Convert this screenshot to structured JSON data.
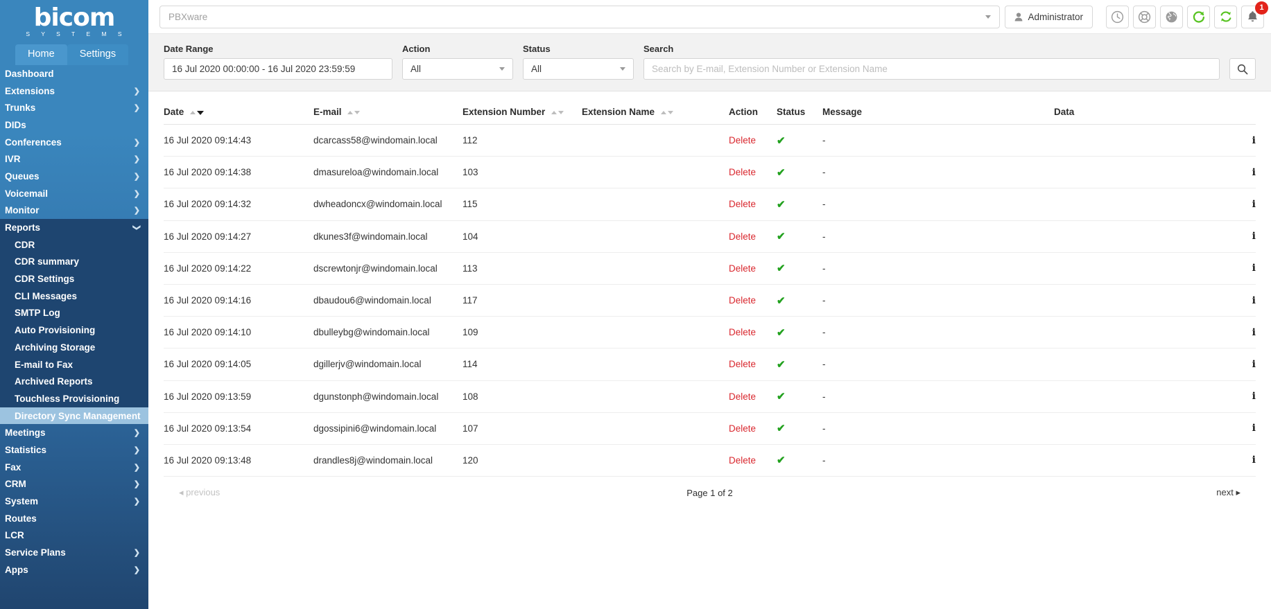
{
  "brand": {
    "name": "bicom",
    "tagline": "S Y S T E M S"
  },
  "tabs": [
    {
      "label": "Home",
      "active": true
    },
    {
      "label": "Settings",
      "active": false
    }
  ],
  "sidebar": {
    "items": [
      {
        "label": "Dashboard",
        "has_arrow": false,
        "expanded": false
      },
      {
        "label": "Extensions",
        "has_arrow": true,
        "expanded": false
      },
      {
        "label": "Trunks",
        "has_arrow": true,
        "expanded": false
      },
      {
        "label": "DIDs",
        "has_arrow": false,
        "expanded": false
      },
      {
        "label": "Conferences",
        "has_arrow": true,
        "expanded": false
      },
      {
        "label": "IVR",
        "has_arrow": true,
        "expanded": false
      },
      {
        "label": "Queues",
        "has_arrow": true,
        "expanded": false
      },
      {
        "label": "Voicemail",
        "has_arrow": true,
        "expanded": false
      },
      {
        "label": "Monitor",
        "has_arrow": true,
        "expanded": false
      },
      {
        "label": "Reports",
        "has_arrow": true,
        "expanded": true
      }
    ],
    "reports_subitems": [
      {
        "label": "CDR",
        "active": false
      },
      {
        "label": "CDR summary",
        "active": false
      },
      {
        "label": "CDR Settings",
        "active": false
      },
      {
        "label": "CLI Messages",
        "active": false
      },
      {
        "label": "SMTP Log",
        "active": false
      },
      {
        "label": "Auto Provisioning",
        "active": false
      },
      {
        "label": "Archiving Storage",
        "active": false
      },
      {
        "label": "E-mail to Fax",
        "active": false
      },
      {
        "label": "Archived Reports",
        "active": false
      },
      {
        "label": "Touchless Provisioning",
        "active": false
      },
      {
        "label": "Directory Sync Management",
        "active": true
      }
    ],
    "items_after": [
      {
        "label": "Meetings",
        "has_arrow": true
      },
      {
        "label": "Statistics",
        "has_arrow": true
      },
      {
        "label": "Fax",
        "has_arrow": true
      },
      {
        "label": "CRM",
        "has_arrow": true
      },
      {
        "label": "System",
        "has_arrow": true
      },
      {
        "label": "Routes",
        "has_arrow": false
      },
      {
        "label": "LCR",
        "has_arrow": false
      },
      {
        "label": "Service Plans",
        "has_arrow": true
      },
      {
        "label": "Apps",
        "has_arrow": true
      }
    ]
  },
  "topbar": {
    "server_select_value": "PBXware",
    "user_label": "Administrator",
    "tools": [
      {
        "name": "clock-icon",
        "title": "Clock"
      },
      {
        "name": "lifebuoy-icon",
        "title": "Support"
      },
      {
        "name": "globe-icon",
        "title": "Language"
      },
      {
        "name": "reload-icon",
        "title": "Reload"
      },
      {
        "name": "sync-icon",
        "title": "Sync"
      },
      {
        "name": "bell-icon",
        "title": "Notifications"
      }
    ],
    "notification_count": "1"
  },
  "filters": {
    "date_range": {
      "label": "Date Range",
      "value": "16 Jul 2020 00:00:00 - 16 Jul 2020 23:59:59"
    },
    "action": {
      "label": "Action",
      "value": "All"
    },
    "status": {
      "label": "Status",
      "value": "All"
    },
    "search": {
      "label": "Search",
      "value": "",
      "placeholder": "Search by E-mail, Extension Number or Extension Name"
    }
  },
  "table": {
    "columns": [
      {
        "key": "date",
        "label": "Date",
        "sortable": true,
        "sort_active": "desc"
      },
      {
        "key": "email",
        "label": "E-mail",
        "sortable": true,
        "sort_active": ""
      },
      {
        "key": "extension_number",
        "label": "Extension Number",
        "sortable": true,
        "sort_active": ""
      },
      {
        "key": "extension_name",
        "label": "Extension Name",
        "sortable": true,
        "sort_active": ""
      },
      {
        "key": "action",
        "label": "Action",
        "sortable": false,
        "sort_active": ""
      },
      {
        "key": "status",
        "label": "Status",
        "sortable": false,
        "sort_active": ""
      },
      {
        "key": "message",
        "label": "Message",
        "sortable": false,
        "sort_active": ""
      },
      {
        "key": "data",
        "label": "Data",
        "sortable": false,
        "sort_active": ""
      }
    ],
    "rows": [
      {
        "date": "16 Jul 2020 09:14:43",
        "email": "dcarcass58@windomain.local",
        "extension_number": "112",
        "extension_name": "",
        "action": "Delete",
        "status": "ok",
        "message": "-",
        "data": "i"
      },
      {
        "date": "16 Jul 2020 09:14:38",
        "email": "dmasureloa@windomain.local",
        "extension_number": "103",
        "extension_name": "",
        "action": "Delete",
        "status": "ok",
        "message": "-",
        "data": "i"
      },
      {
        "date": "16 Jul 2020 09:14:32",
        "email": "dwheadoncx@windomain.local",
        "extension_number": "115",
        "extension_name": "",
        "action": "Delete",
        "status": "ok",
        "message": "-",
        "data": "i"
      },
      {
        "date": "16 Jul 2020 09:14:27",
        "email": "dkunes3f@windomain.local",
        "extension_number": "104",
        "extension_name": "",
        "action": "Delete",
        "status": "ok",
        "message": "-",
        "data": "i"
      },
      {
        "date": "16 Jul 2020 09:14:22",
        "email": "dscrewtonjr@windomain.local",
        "extension_number": "113",
        "extension_name": "",
        "action": "Delete",
        "status": "ok",
        "message": "-",
        "data": "i"
      },
      {
        "date": "16 Jul 2020 09:14:16",
        "email": "dbaudou6@windomain.local",
        "extension_number": "117",
        "extension_name": "",
        "action": "Delete",
        "status": "ok",
        "message": "-",
        "data": "i"
      },
      {
        "date": "16 Jul 2020 09:14:10",
        "email": "dbulleybg@windomain.local",
        "extension_number": "109",
        "extension_name": "",
        "action": "Delete",
        "status": "ok",
        "message": "-",
        "data": "i"
      },
      {
        "date": "16 Jul 2020 09:14:05",
        "email": "dgillerjv@windomain.local",
        "extension_number": "114",
        "extension_name": "",
        "action": "Delete",
        "status": "ok",
        "message": "-",
        "data": "i"
      },
      {
        "date": "16 Jul 2020 09:13:59",
        "email": "dgunstonph@windomain.local",
        "extension_number": "108",
        "extension_name": "",
        "action": "Delete",
        "status": "ok",
        "message": "-",
        "data": "i"
      },
      {
        "date": "16 Jul 2020 09:13:54",
        "email": "dgossipini6@windomain.local",
        "extension_number": "107",
        "extension_name": "",
        "action": "Delete",
        "status": "ok",
        "message": "-",
        "data": "i"
      },
      {
        "date": "16 Jul 2020 09:13:48",
        "email": "drandles8j@windomain.local",
        "extension_number": "120",
        "extension_name": "",
        "action": "Delete",
        "status": "ok",
        "message": "-",
        "data": "i"
      }
    ]
  },
  "pagination": {
    "previous_label": "previous",
    "page_label": "Page 1 of 2",
    "next_label": "next"
  },
  "colors": {
    "sidebar_top": "#3a86bd",
    "sidebar_bottom": "#20456f",
    "active_subitem": "#9cc3e0",
    "delete_red": "#d9272e",
    "ok_green": "#22a11e",
    "badge_red": "#e2231a",
    "tool_green": "#58c322"
  }
}
